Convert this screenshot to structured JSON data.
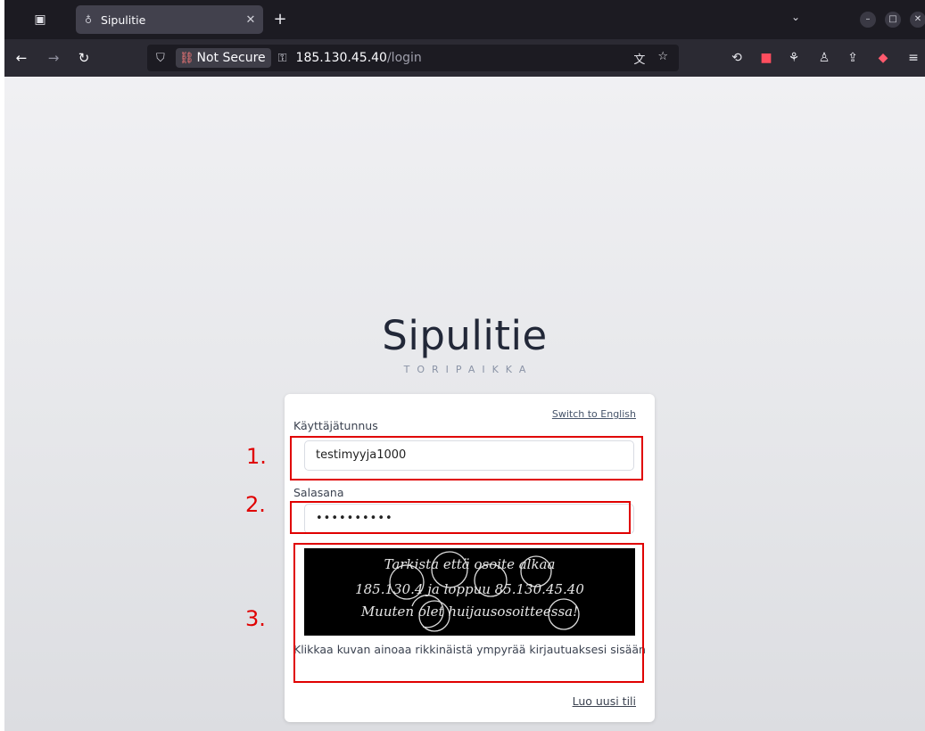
{
  "browser": {
    "tab": {
      "title": "Sipulitie",
      "favicon": "onion-icon"
    },
    "address": {
      "security_label": "Not Secure",
      "host": "185.130.45.40",
      "path": "/login"
    }
  },
  "page": {
    "brand_title": "Sipulitie",
    "brand_tagline": "TORIPAIKKA",
    "language_switch": "Switch to English",
    "username": {
      "label": "Käyttäjätunnus",
      "value": "testimyyja1000"
    },
    "password": {
      "label": "Salasana",
      "value": "••••••••••"
    },
    "captcha": {
      "lines": [
        "Tarkista että osoite alkaa",
        "185.130.4 ja loppuu 85.130.45.40",
        "Muuten olet huijausosoitteessa!"
      ],
      "circle_count": 7
    },
    "captcha_hint": "Klikkaa kuvan ainoaa rikkinäistä ympyrää kirjautuaksesi sisään",
    "register_link": "Luo uusi tili"
  },
  "annotations": {
    "labels": [
      "1.",
      "2.",
      "3."
    ],
    "color": "#e00000"
  }
}
